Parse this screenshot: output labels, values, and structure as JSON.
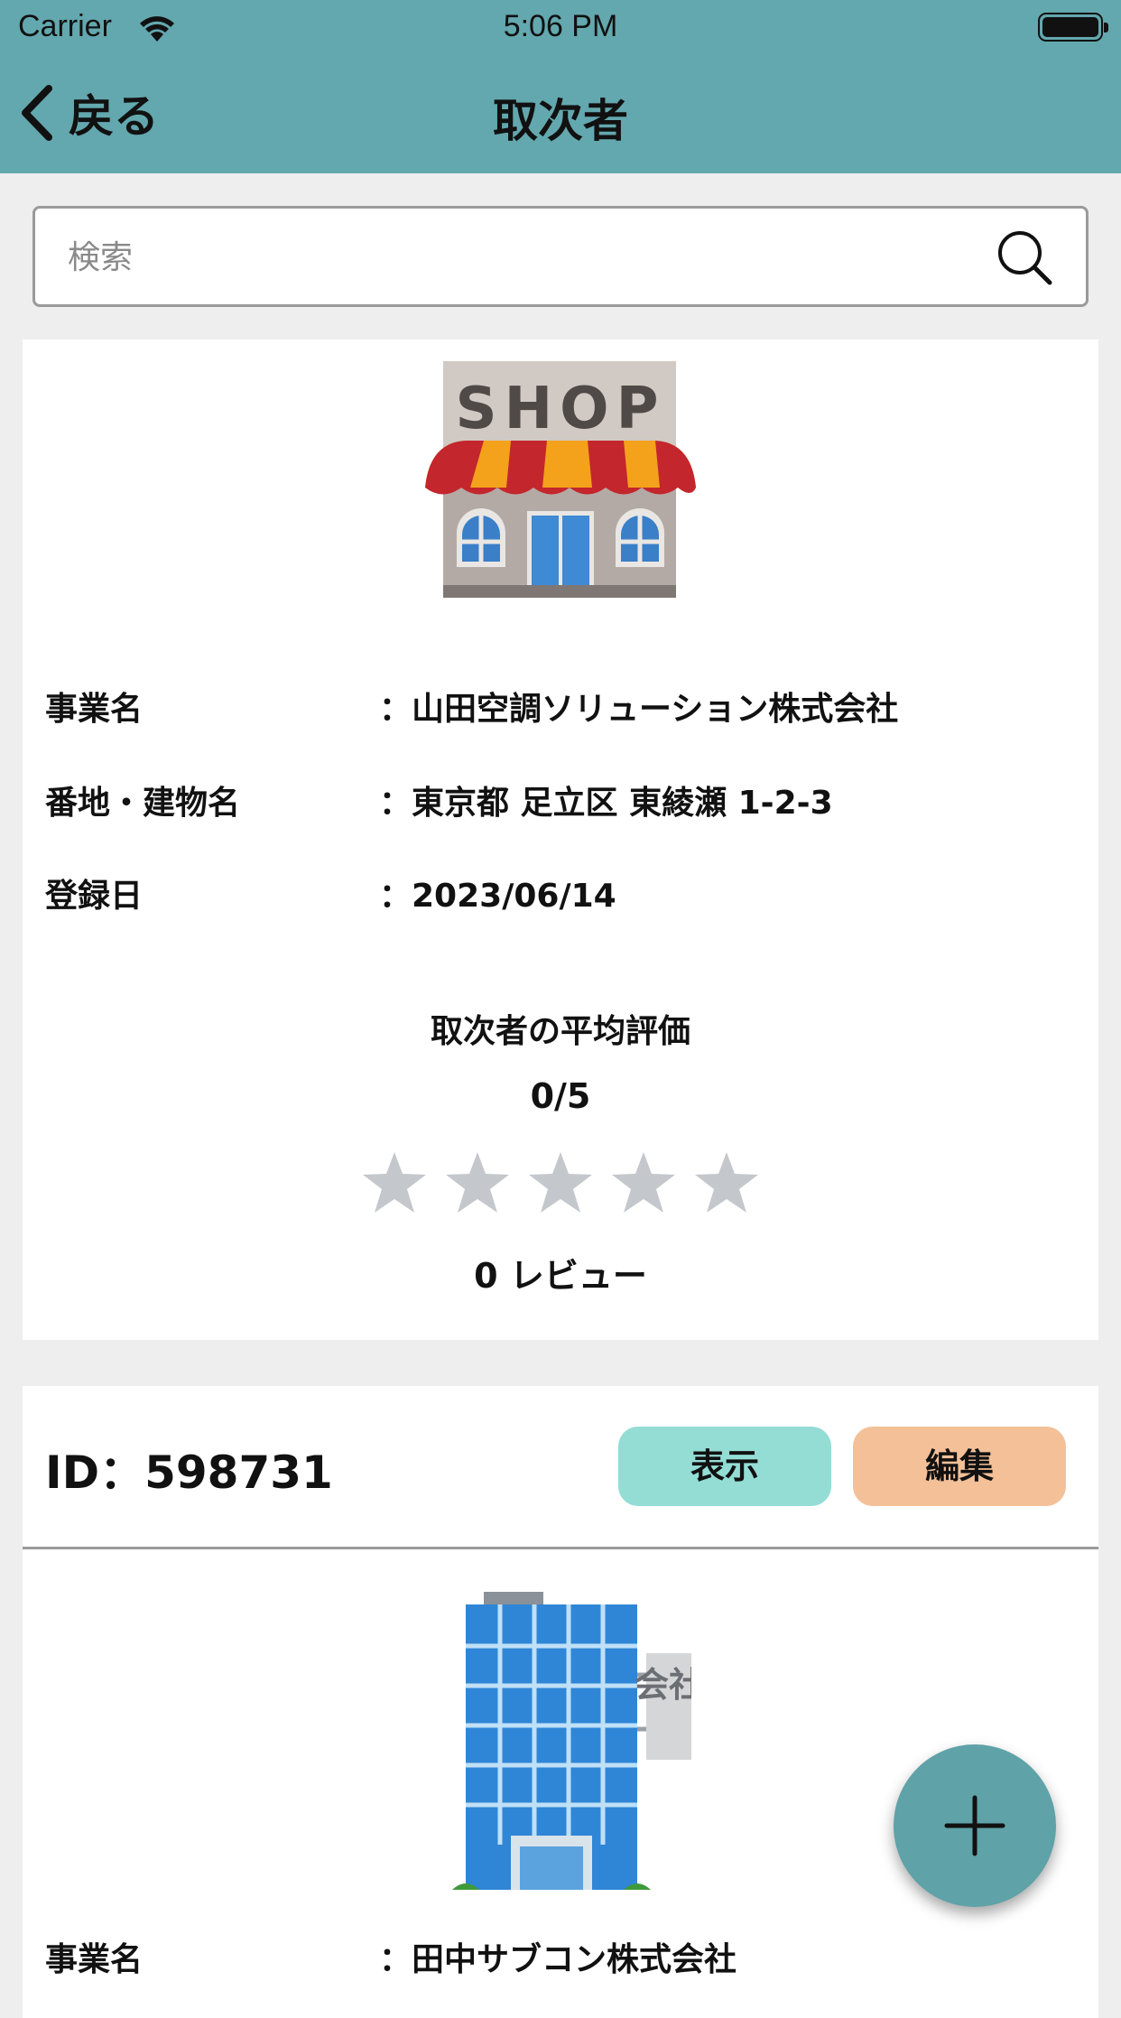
{
  "status_bar": {
    "carrier": "Carrier",
    "time": "5:06 PM"
  },
  "nav": {
    "back_label": "戻る",
    "title": "取次者"
  },
  "search": {
    "placeholder": "検索"
  },
  "card1": {
    "labels": {
      "business_name": "事業名",
      "address": "番地・建物名",
      "registered": "登録日"
    },
    "values": {
      "business_name": "：山田空調ソリューション株式会社",
      "address": "：東京都 足立区 東綾瀬 1-2-3",
      "registered": "：2023/06/14"
    },
    "rating_title": "取次者の平均評価",
    "rating_score": "0/5",
    "rating_value": 0,
    "rating_max": 5,
    "reviews": "0 レビュー",
    "shop_sign": "SHOP"
  },
  "card2": {
    "id_label": "ID：598731",
    "view_button": "表示",
    "edit_button": "編集",
    "labels": {
      "business_name": "事業名"
    },
    "values": {
      "business_name": "：田中サブコン株式会社"
    },
    "building_sign": "会社"
  },
  "colors": {
    "header": "#63a8ae",
    "view_button": "#93ddd5",
    "edit_button": "#f3c098",
    "fab": "#5fa2a8",
    "star_empty": "#c4c8cc"
  }
}
